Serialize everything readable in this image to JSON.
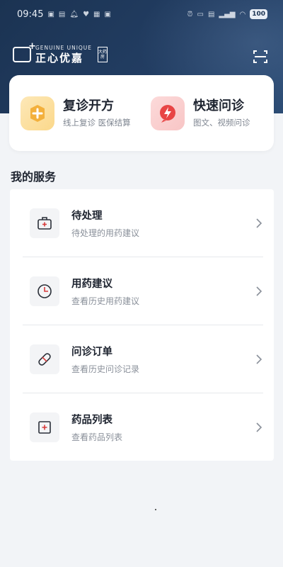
{
  "status_bar": {
    "time": "09:45",
    "battery": "100"
  },
  "brand": {
    "en": "GENUINE UNIQUE",
    "cn": "正心优嘉",
    "seal": "大药房"
  },
  "quick_actions": [
    {
      "title": "复诊开方",
      "subtitle": "线上复诊 医保结算",
      "icon": "plus-icon"
    },
    {
      "title": "快速问诊",
      "subtitle": "图文、视频问诊",
      "icon": "lightning-icon"
    }
  ],
  "section": {
    "title": "我的服务"
  },
  "services": [
    {
      "title": "待处理",
      "subtitle": "待处理的用药建议",
      "icon": "medical-kit-icon"
    },
    {
      "title": "用药建议",
      "subtitle": "查看历史用药建议",
      "icon": "clock-icon"
    },
    {
      "title": "问诊订单",
      "subtitle": "查看历史问诊记录",
      "icon": "pill-icon"
    },
    {
      "title": "药品列表",
      "subtitle": "查看药品列表",
      "icon": "medicine-box-icon"
    }
  ],
  "colors": {
    "header": "#1b3352",
    "accent_orange": "#f3b03c",
    "accent_red": "#e84545",
    "icon_red": "#d83a3a"
  }
}
